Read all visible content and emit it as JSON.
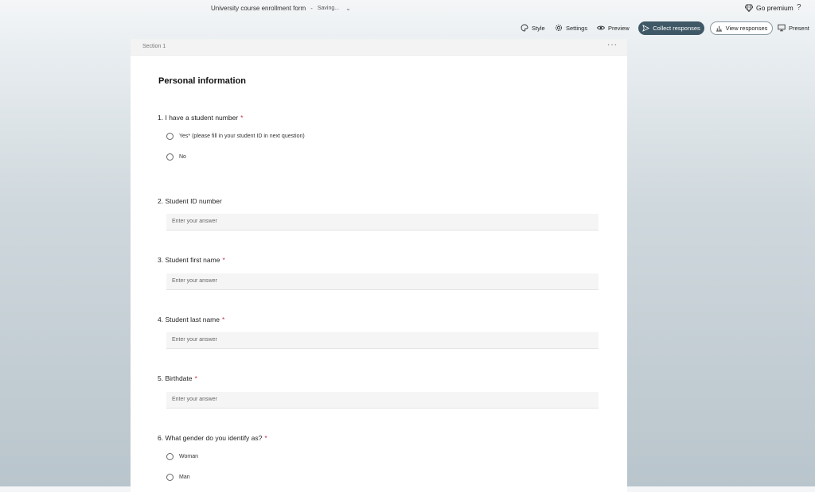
{
  "header": {
    "form_title": "University course enrollment form",
    "separator": "-",
    "status": "Saving...",
    "premium_label": "Go premium",
    "help": "?"
  },
  "toolbar": {
    "style": "Style",
    "settings": "Settings",
    "preview": "Preview",
    "collect": "Collect responses",
    "view": "View responses",
    "present": "Present"
  },
  "section": {
    "label": "Section 1",
    "more": "···"
  },
  "form": {
    "heading": "Personal information",
    "placeholder": "Enter your answer",
    "questions": [
      {
        "number": "1.",
        "text": "I have a student number",
        "required": "*",
        "options": [
          "Yes* (please fill in your student ID in next question)",
          "No"
        ]
      },
      {
        "number": "2.",
        "text": "Student ID number",
        "required": ""
      },
      {
        "number": "3.",
        "text": "Student first name",
        "required": "*"
      },
      {
        "number": "4.",
        "text": "Student last name",
        "required": "*"
      },
      {
        "number": "5.",
        "text": "Birthdate",
        "required": "*"
      },
      {
        "number": "6.",
        "text": "What gender do you identify as?",
        "required": "*",
        "options": [
          "Woman",
          "Man"
        ]
      }
    ]
  },
  "colors": {
    "primary_button": "#3f5866",
    "required_star": "#c4314b"
  }
}
